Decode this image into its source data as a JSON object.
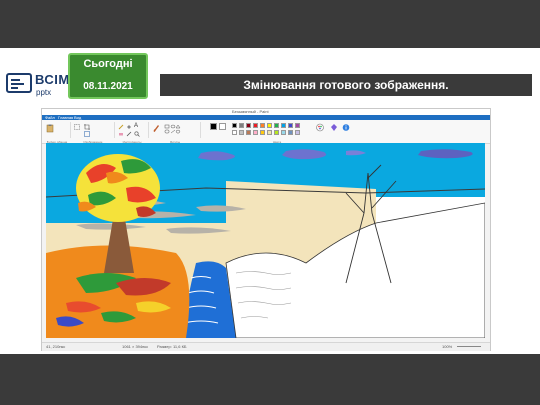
{
  "slide": {
    "logo_text": "ВСІМ",
    "logo_sub": "pptx",
    "badge_top": "Сьогодні",
    "badge_date": "08.11.2021",
    "banner_title": "Змінювання готового зображення."
  },
  "paint": {
    "window_title": "Безымянный - Paint",
    "menu": [
      "Файл",
      "Главная",
      "Вид"
    ],
    "groups": [
      "Буфер обмена",
      "Изображение",
      "Инструменты",
      "Фигуры",
      "Цвета"
    ],
    "status": {
      "position": "41, 210пкс",
      "selection": "",
      "size": "1061 × 394пкс",
      "file_size": "Размер: 11,6 КБ",
      "zoom": "100%"
    },
    "colors": [
      "#000000",
      "#7f7f7f",
      "#880015",
      "#ed1c24",
      "#ff7f27",
      "#fff200",
      "#22b14c",
      "#00a2e8",
      "#3f48cc",
      "#a349a4",
      "#ffffff",
      "#c3c3c3",
      "#b97a57",
      "#ffaec9",
      "#ffc90e",
      "#efe4b0",
      "#b5e61d",
      "#99d9ea",
      "#7092be",
      "#c8bfe7"
    ]
  }
}
